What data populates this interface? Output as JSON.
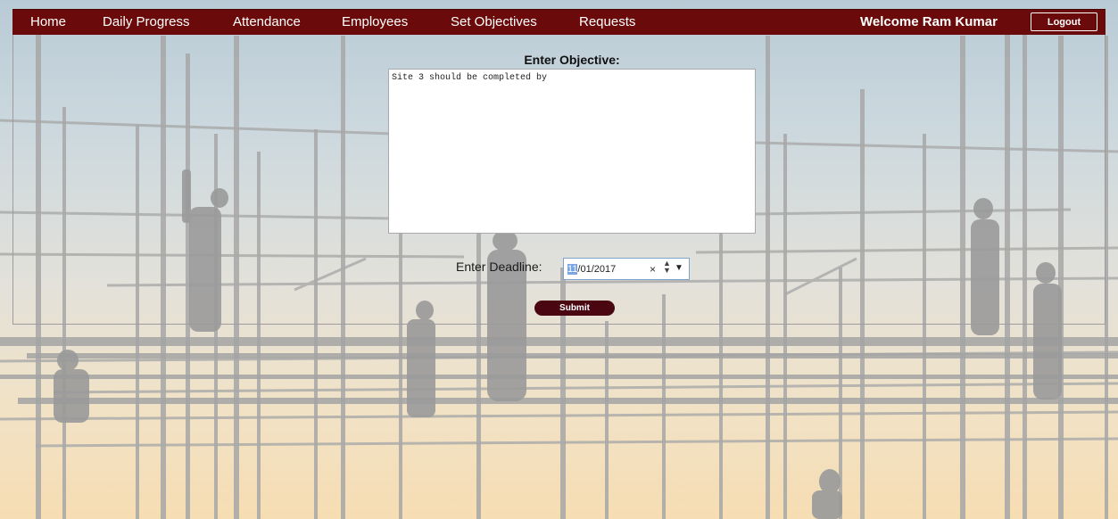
{
  "nav": {
    "items": [
      {
        "label": "Home"
      },
      {
        "label": "Daily Progress"
      },
      {
        "label": "Attendance"
      },
      {
        "label": "Employees"
      },
      {
        "label": "Set Objectives"
      },
      {
        "label": "Requests"
      }
    ],
    "welcome": "Welcome Ram Kumar",
    "logout_label": "Logout"
  },
  "form": {
    "objective_label": "Enter Objective:",
    "objective_value": "Site 3 should be completed by",
    "deadline_label": "Enter Deadline:",
    "deadline_month": "11",
    "deadline_rest": "/01/2017",
    "clear_glyph": "×",
    "spin_up": "▲",
    "spin_down": "▼",
    "dropdown_glyph": "▼",
    "submit_label": "Submit"
  },
  "colors": {
    "navbar": "#6a0a0a",
    "submit": "#4a0712",
    "sky_top": "#b9cbd6",
    "sky_bottom": "#f6ddb3"
  }
}
